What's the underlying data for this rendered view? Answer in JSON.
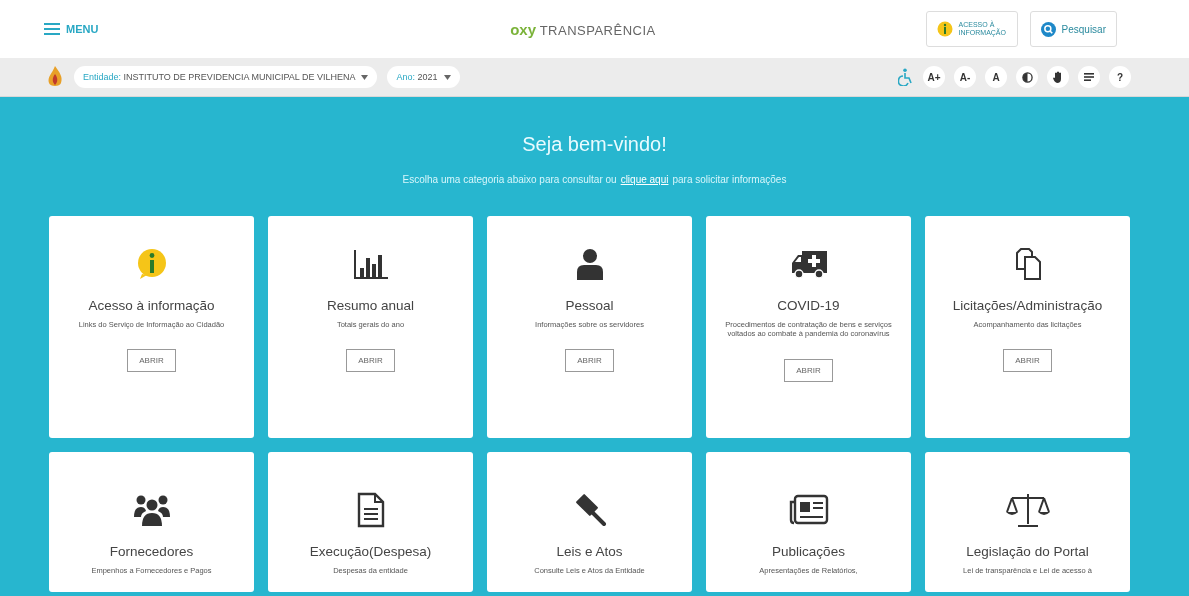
{
  "header": {
    "menu_label": "MENU",
    "logo_brand": "oxy",
    "logo_text": "TRANSPARÊNCIA",
    "access_button": "ACESSO À INFORMAÇÃO",
    "search_button": "Pesquisar"
  },
  "toolbar": {
    "entity_label": "Entidade:",
    "entity_value": "INSTITUTO DE PREVIDENCIA MUNICIPAL DE VILHENA",
    "year_label": "Ano:",
    "year_value": "2021",
    "text_buttons": [
      "A+",
      "A-",
      "A"
    ],
    "help_button": "?"
  },
  "welcome": {
    "title": "Seja bem-vindo!",
    "before_link": "Escolha uma categoria abaixo para consultar ou",
    "link": "clique aqui",
    "after_link": "para solicitar informações"
  },
  "cards": [
    {
      "title": "Acesso à informação",
      "description": "Links do Serviço de Informação ao Cidadão",
      "button": "ABRIR"
    },
    {
      "title": "Resumo anual",
      "description": "Totais gerais do ano",
      "button": "ABRIR"
    },
    {
      "title": "Pessoal",
      "description": "Informações sobre os servidores",
      "button": "ABRIR"
    },
    {
      "title": "COVID-19",
      "description": "Procedimentos de contratação de bens e serviços voltados ao combate à pandemia do coronavírus",
      "button": "ABRIR"
    },
    {
      "title": "Licitações/Administração",
      "description": "Acompanhamento das licitações",
      "button": "ABRIR"
    },
    {
      "title": "Fornecedores",
      "description": "Empenhos a Fornecedores e Pagos"
    },
    {
      "title": "Execução(Despesa)",
      "description": "Despesas da entidade"
    },
    {
      "title": "Leis e Atos",
      "description": "Consulte Leis e Atos da Entidade"
    },
    {
      "title": "Publicações",
      "description": "Apresentações de Relatórios,"
    },
    {
      "title": "Legislação do Portal",
      "description": "Lei de transparência e Lei de acesso à"
    }
  ]
}
